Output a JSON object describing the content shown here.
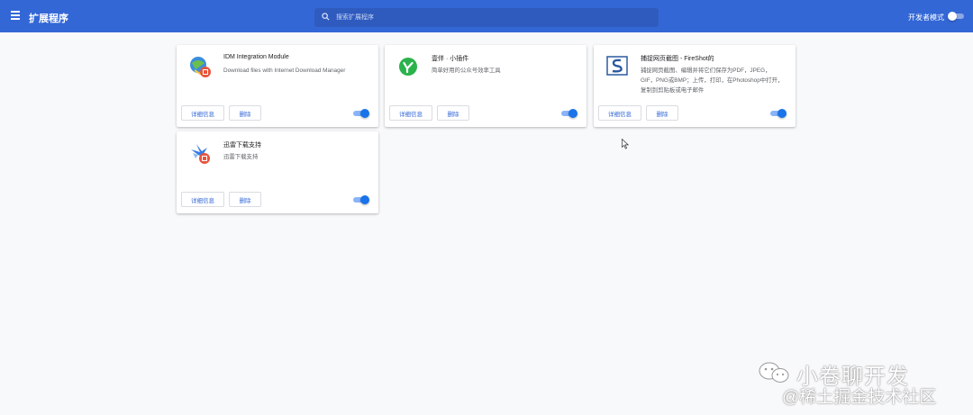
{
  "header": {
    "menu_icon": "hamburger-menu-icon",
    "title": "扩展程序",
    "search_placeholder": "搜索扩展程序",
    "search_icon": "search-icon",
    "dev_mode_label": "开发者模式",
    "dev_mode_on": false
  },
  "extensions": [
    {
      "name": "IDM Integration Module",
      "description": "Download files with Internet Download Manager",
      "icon": "idm-icon",
      "details_label": "详细信息",
      "remove_label": "删除",
      "enabled": true
    },
    {
      "name": "壹伴 · 小插件",
      "description": "简单好用的公众号效率工具",
      "icon": "yiban-icon",
      "details_label": "详细信息",
      "remove_label": "删除",
      "enabled": true
    },
    {
      "name": "捕捉网页截图 - FireShot的",
      "description": "捕捉网页截图、编辑并将它们保存为PDF，JPEG，GIF，PNG或BMP；上传，打印，在Photoshop中打开，复制到剪贴板或电子邮件",
      "icon": "fireshot-icon",
      "details_label": "详细信息",
      "remove_label": "删除",
      "enabled": true
    },
    {
      "name": "迅雷下载支持",
      "description": "迅雷下载支持",
      "icon": "thunder-icon",
      "details_label": "详细信息",
      "remove_label": "删除",
      "enabled": true
    }
  ],
  "watermark": {
    "line1": "小卷聊开发",
    "line2": "@稀土掘金技术社区"
  },
  "colors": {
    "header_bg": "#3367d6",
    "accent": "#1a73e8",
    "background": "#f8f9fa"
  }
}
